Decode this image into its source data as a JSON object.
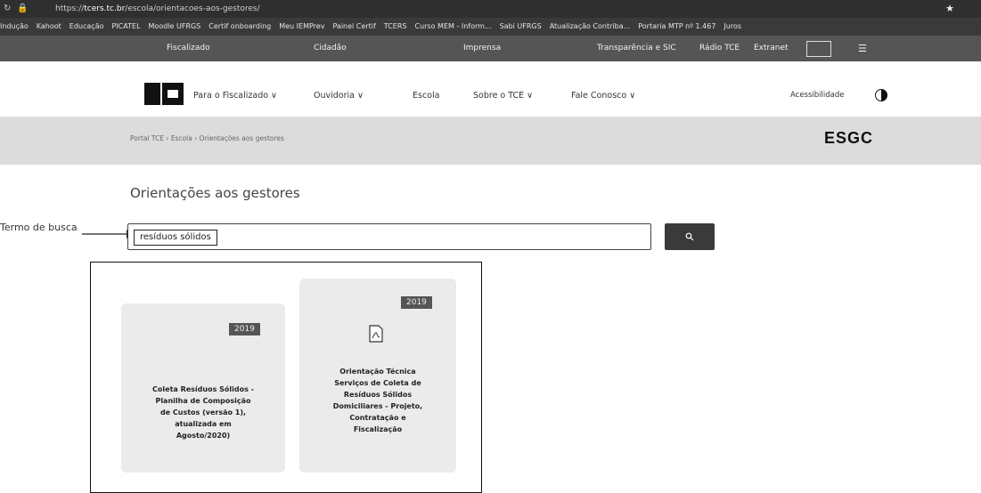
{
  "browser": {
    "url_prefix": "https://",
    "url_host": "tcers.tc.br",
    "url_path": "/escola/orientacoes-aos-gestores/",
    "bookmarks": [
      "Indução",
      "Kahoot",
      "Educação",
      "PICATEL",
      "Moodle UFRGS",
      "Certif onboarding",
      "Meu IEMPrev",
      "Painel Certif",
      "TCERS",
      "Curso MEM - Inform...",
      "Sabi UFRGS",
      "Atualização Contriba...",
      "Portaria MTP nº 1.467",
      "Juros"
    ]
  },
  "topbar": {
    "left": [
      "Fiscalizado",
      "Cidadão",
      "Imprensa"
    ],
    "right": [
      "Transparência e SIC",
      "Rádio TCE",
      "Extranet"
    ]
  },
  "nav": {
    "items": [
      "Para o Fiscalizado ∨",
      "Ouvidoria ∨",
      "Escola",
      "Sobre o TCE ∨",
      "Fale Conosco ∨"
    ],
    "accessibility": "Acessibilidade"
  },
  "breadcrumb": {
    "text": "Portal TCE  ›  Escola  ›  Orientações aos gestores"
  },
  "brand": "ESGC",
  "page": {
    "title": "Orientações aos gestores"
  },
  "annotation": "Termo de busca",
  "search": {
    "value": "resíduos sólidos"
  },
  "results": [
    {
      "year": "2019",
      "title_lines": [
        "Coleta Resíduos Sólidos -",
        "Planilha de Composição",
        "de Custos (versão 1),",
        "atualizada em",
        "Agosto/2020)"
      ]
    },
    {
      "year": "2019",
      "title_lines": [
        "Orientação Técnica",
        "Serviços de Coleta de",
        "Resíduos Sólidos",
        "Domiciliares - Projeto,",
        "Contratação e",
        "Fiscalização"
      ]
    }
  ]
}
